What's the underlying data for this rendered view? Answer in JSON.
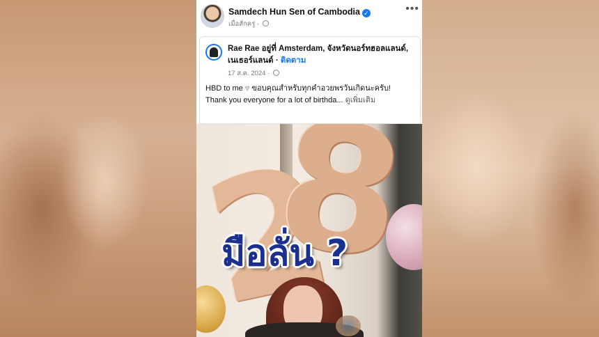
{
  "post": {
    "page_name": "Samdech Hun Sen of Cambodia",
    "time": "เมื่อสักครู่",
    "separator": "·",
    "more": "•••"
  },
  "shared_post": {
    "author": "Rae Rae",
    "location_text": "อยู่ที่ Amsterdam, จังหวัดนอร์ทฮอลแลนด์, เนเธอร์แลนด์",
    "separator": "·",
    "follow": "ติดตาม",
    "date": "17 ส.ค. 2024",
    "caption_line1_a": "HBD to me",
    "caption_line1_b": "ขอบคุณสำหรับทุกคำอวยพรวันเกิดนะครับ!",
    "caption_line2": "Thank you everyone for a lot of birthda...",
    "see_more": "ดูเพิ่มเติม"
  },
  "photo": {
    "balloon_digit_1": "2",
    "balloon_digit_2": "8"
  },
  "overlay": {
    "text": "มือลั่น ?",
    "color": "#1b2f8f"
  },
  "icons": [
    "verified-icon",
    "globe-icon",
    "more-icon",
    "heart-icon"
  ]
}
